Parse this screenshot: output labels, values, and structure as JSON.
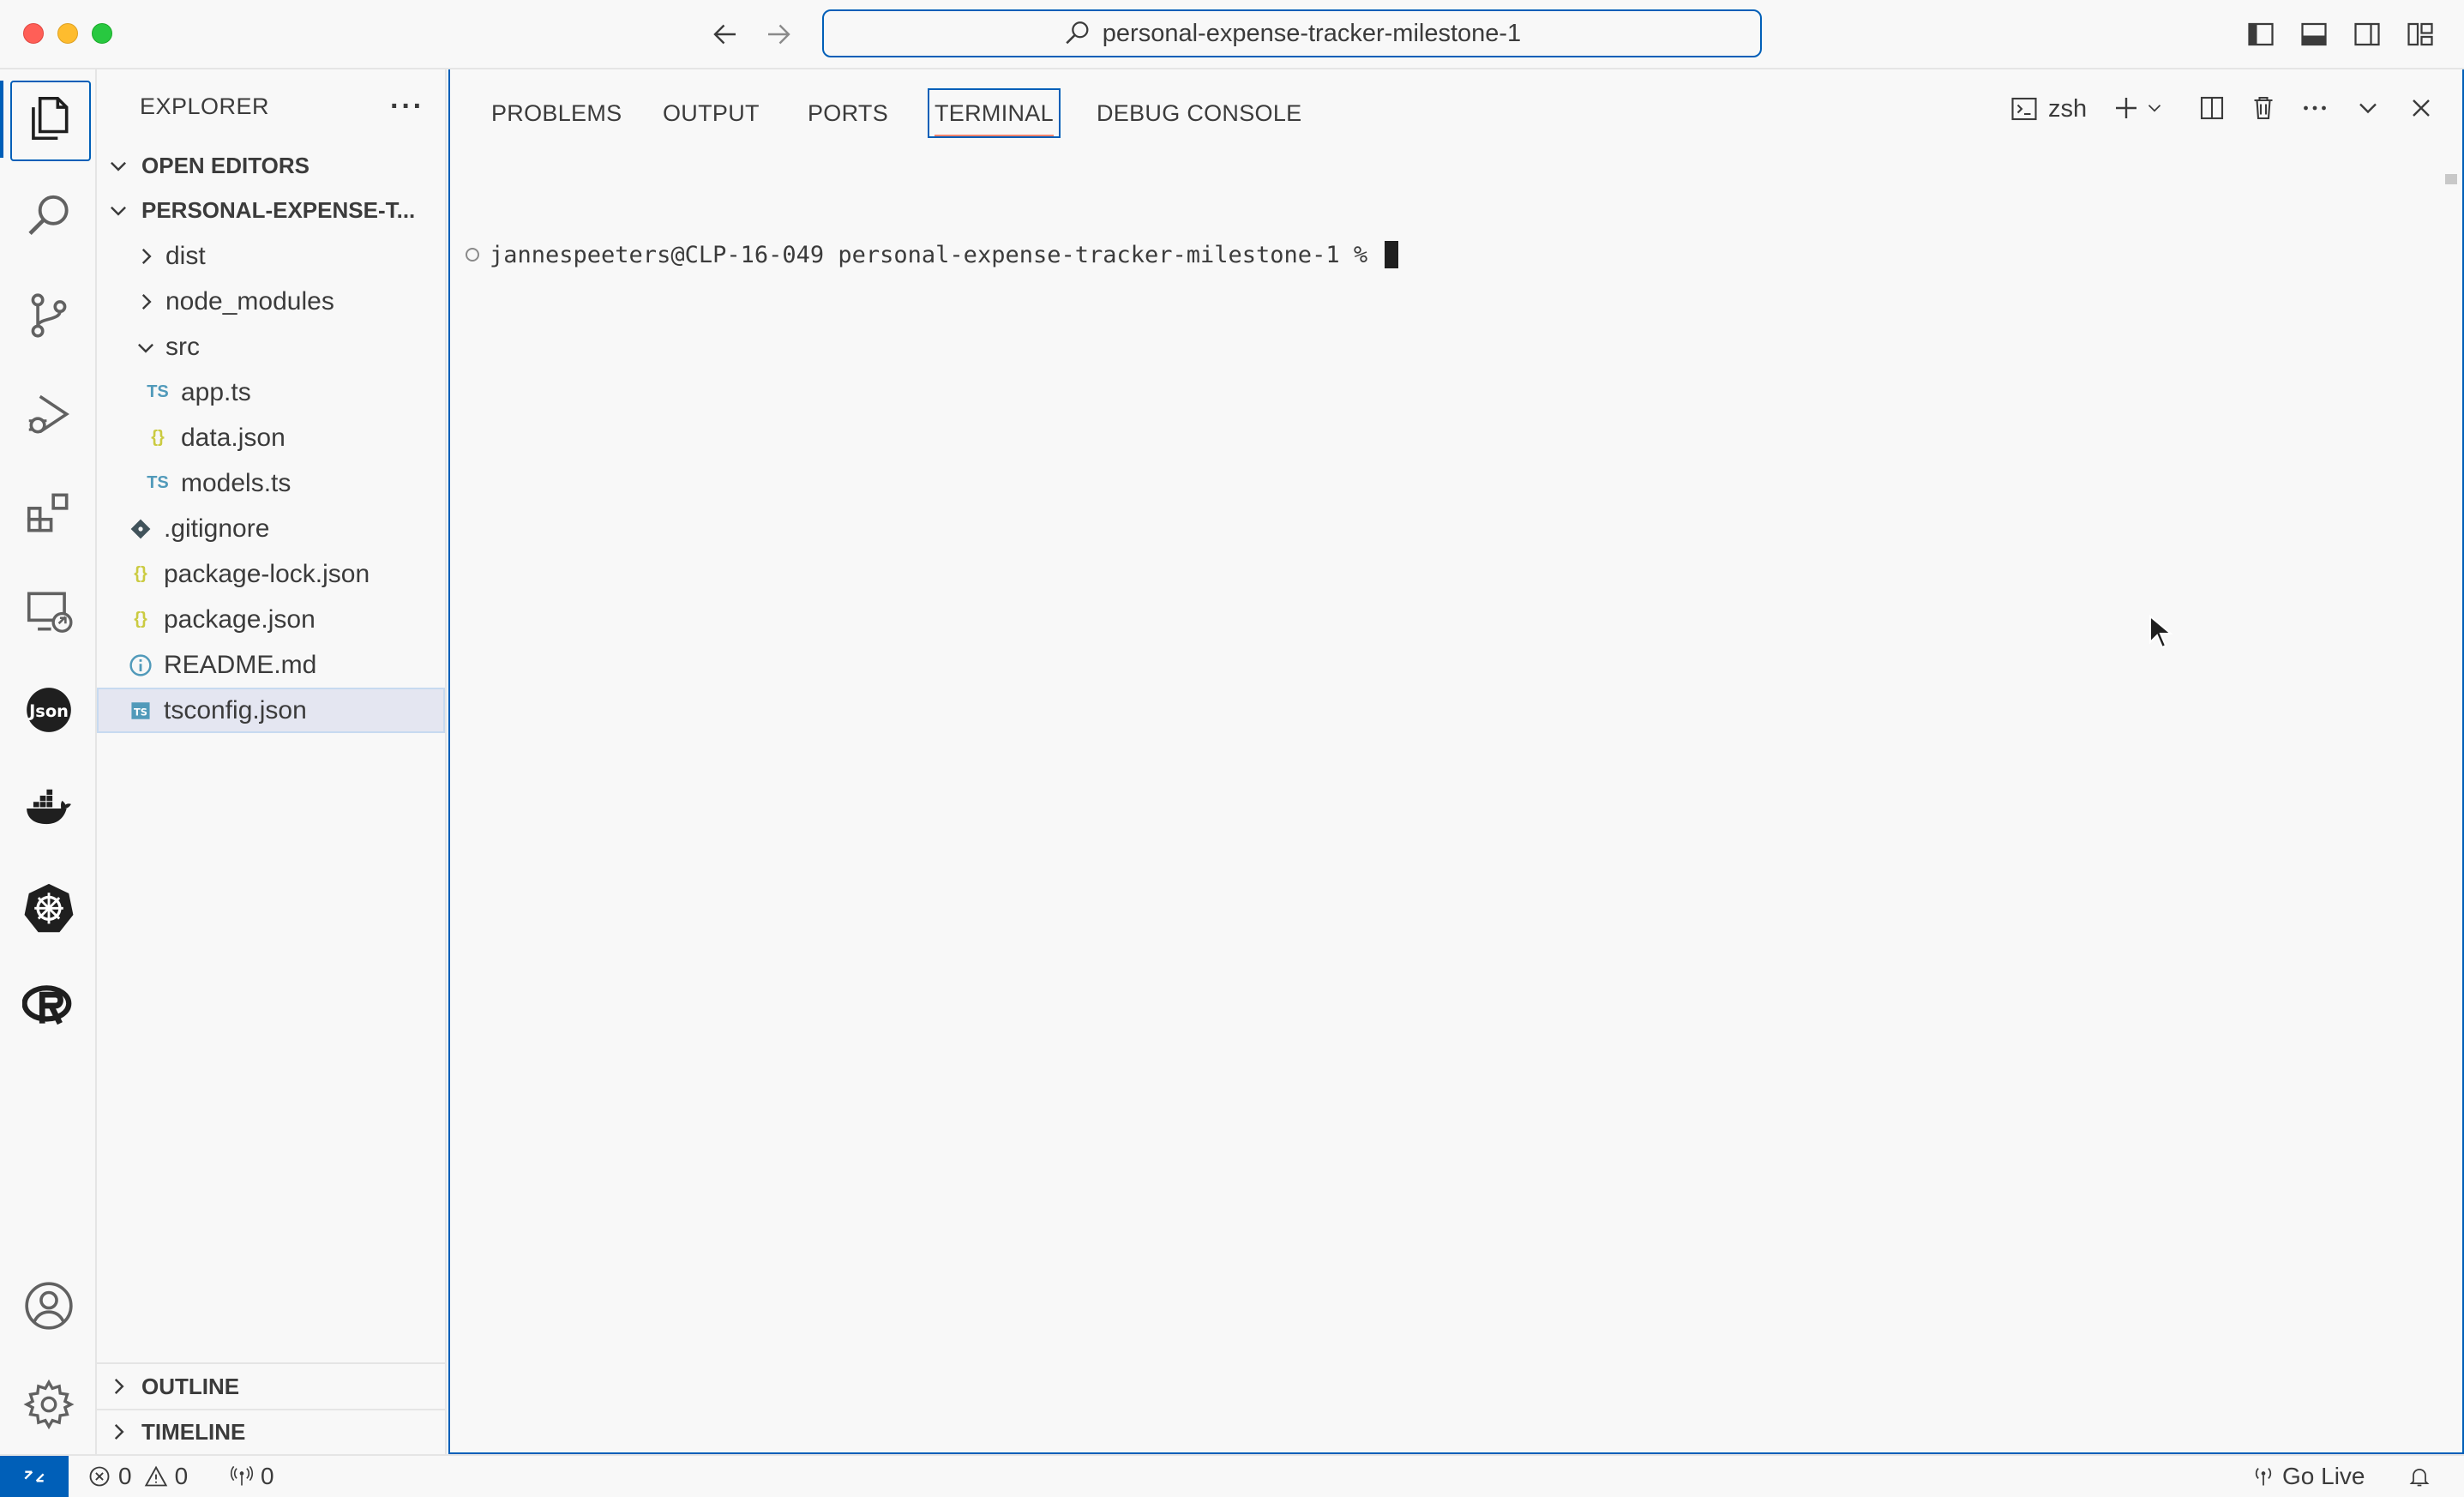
{
  "titlebar": {
    "command_center": "personal-expense-tracker-milestone-1"
  },
  "activity_bar": {
    "items": [
      "explorer-icon",
      "search-icon",
      "source-control-icon",
      "run-debug-icon",
      "extensions-icon",
      "remote-explorer-icon",
      "json-icon",
      "docker-icon",
      "kubernetes-icon",
      "r-language-icon"
    ],
    "bottom": [
      "account-icon",
      "gear-icon"
    ]
  },
  "sidebar": {
    "title": "EXPLORER",
    "more": "···",
    "open_editors": "OPEN EDITORS",
    "project": "PERSONAL-EXPENSE-T...",
    "tree": [
      {
        "label": "dist",
        "type": "folder",
        "expanded": false
      },
      {
        "label": "node_modules",
        "type": "folder",
        "expanded": false
      },
      {
        "label": "src",
        "type": "folder",
        "expanded": true
      },
      {
        "label": "app.ts",
        "type": "ts"
      },
      {
        "label": "data.json",
        "type": "json"
      },
      {
        "label": "models.ts",
        "type": "ts"
      },
      {
        "label": ".gitignore",
        "type": "git"
      },
      {
        "label": "package-lock.json",
        "type": "json"
      },
      {
        "label": "package.json",
        "type": "json"
      },
      {
        "label": "README.md",
        "type": "info"
      },
      {
        "label": "tsconfig.json",
        "type": "tsconfig",
        "selected": true
      }
    ],
    "outline": "OUTLINE",
    "timeline": "TIMELINE"
  },
  "panel": {
    "tabs": [
      "PROBLEMS",
      "OUTPUT",
      "PORTS",
      "TERMINAL",
      "DEBUG CONSOLE"
    ],
    "active_tab": "TERMINAL",
    "shell": "zsh",
    "terminal_prompt": "jannespeeters@CLP-16-049 personal-expense-tracker-milestone-1 % "
  },
  "statusbar": {
    "errors": "0",
    "warnings": "0",
    "ports": "0",
    "go_live": "Go Live"
  },
  "colors": {
    "accent": "#005fb8",
    "ts": "#519aba",
    "json": "#cbcb41",
    "tab_underline": "#f9826c"
  }
}
